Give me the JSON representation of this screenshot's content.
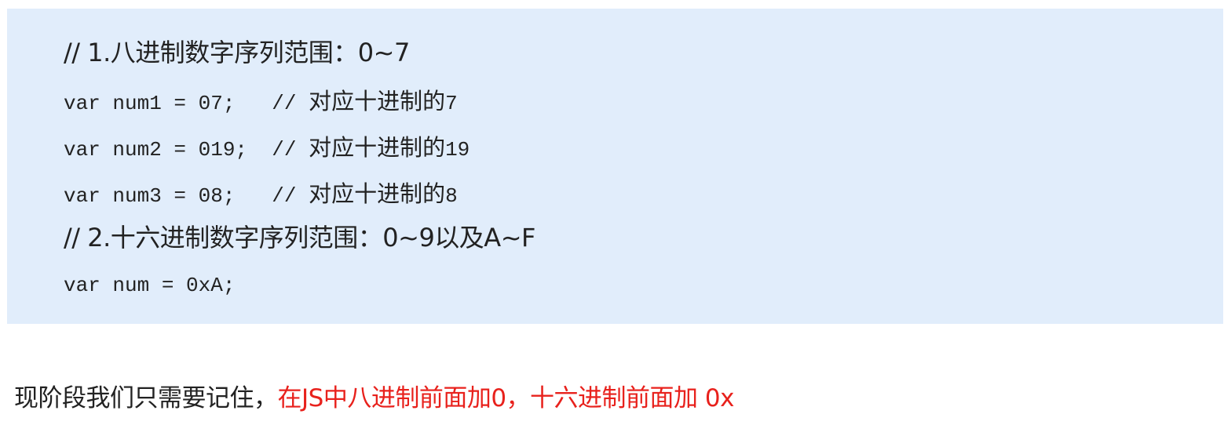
{
  "code_block": {
    "comment_octal": "// 1.八进制数字序列范围：0~7",
    "lines": [
      {
        "code": "var num1 = 07;   // ",
        "cn": "对应十进制的",
        "tail": "7"
      },
      {
        "code": "var num2 = 019;  // ",
        "cn": "对应十进制的",
        "tail": "19"
      },
      {
        "code": "var num3 = 08;   // ",
        "cn": "对应十进制的",
        "tail": "8"
      }
    ],
    "comment_hex": "// 2.十六进制数字序列范围：0~9以及A~F",
    "hex_line": "var num = 0xA;"
  },
  "note": {
    "plain": "现阶段我们只需要记住，",
    "highlight": "在JS中八进制前面加0，十六进制前面加 0x"
  },
  "colors": {
    "code_background": "#e1edfb",
    "text": "#222222",
    "highlight": "#e8211c"
  }
}
